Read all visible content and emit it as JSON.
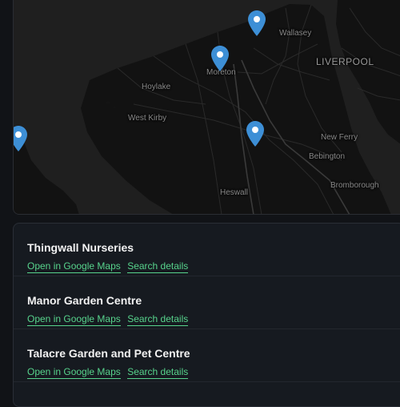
{
  "map": {
    "labels": {
      "wallasey": "Wallasey",
      "liverpool": "LIVERPOOL",
      "moreton": "Moreton",
      "hoylake": "Hoylake",
      "west_kirby": "West Kirby",
      "new_ferry": "New Ferry",
      "bebington": "Bebington",
      "heswall": "Heswall",
      "bromborough": "Bromborough"
    },
    "marker_icon": "map-pin-icon",
    "marker_color": "#3d8fd6",
    "land_color": "#121212",
    "water_color": "#1f1f1f"
  },
  "results": [
    {
      "name": "Thingwall Nurseries",
      "maps_link": "Open in Google Maps",
      "details_link": "Search details"
    },
    {
      "name": "Manor Garden Centre",
      "maps_link": "Open in Google Maps",
      "details_link": "Search details"
    },
    {
      "name": "Talacre Garden and Pet Centre",
      "maps_link": "Open in Google Maps",
      "details_link": "Search details"
    }
  ],
  "colors": {
    "link": "#57d38c",
    "background": "#111317",
    "panel": "#161a20"
  }
}
